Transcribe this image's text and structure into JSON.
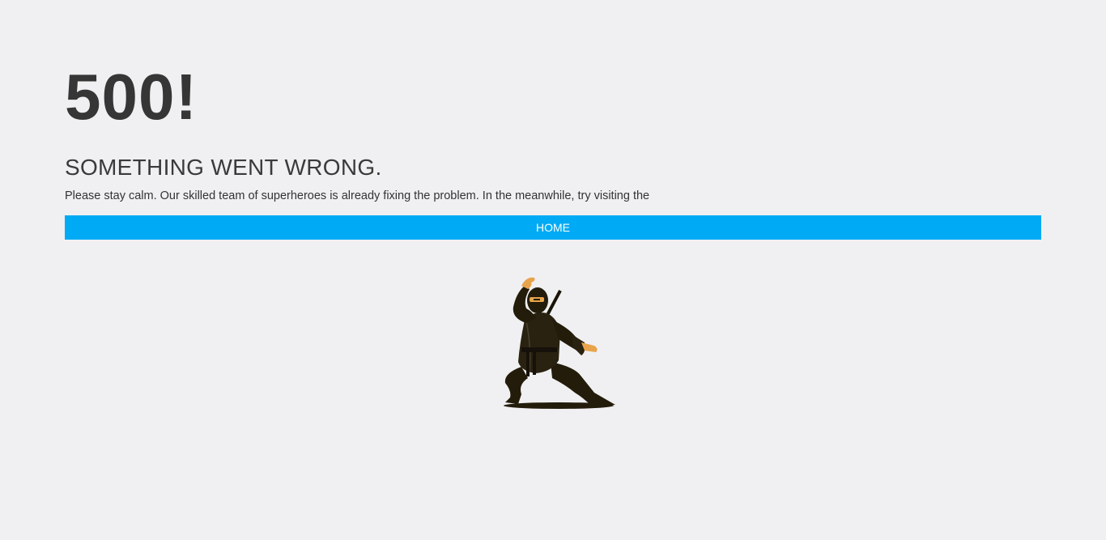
{
  "error": {
    "code": "500!",
    "title": "SOMETHING WENT WRONG.",
    "message": "Please stay calm. Our skilled team of superheroes is already fixing the problem. In the meanwhile, try visiting the"
  },
  "home_button": {
    "label": "HOME"
  },
  "illustration": {
    "icon": "ninja-illustration"
  },
  "colors": {
    "background": "#f0f0f2",
    "accent": "#00aaf5",
    "text": "#333333",
    "ninja": "#231c0a",
    "skin": "#e8a44c"
  }
}
